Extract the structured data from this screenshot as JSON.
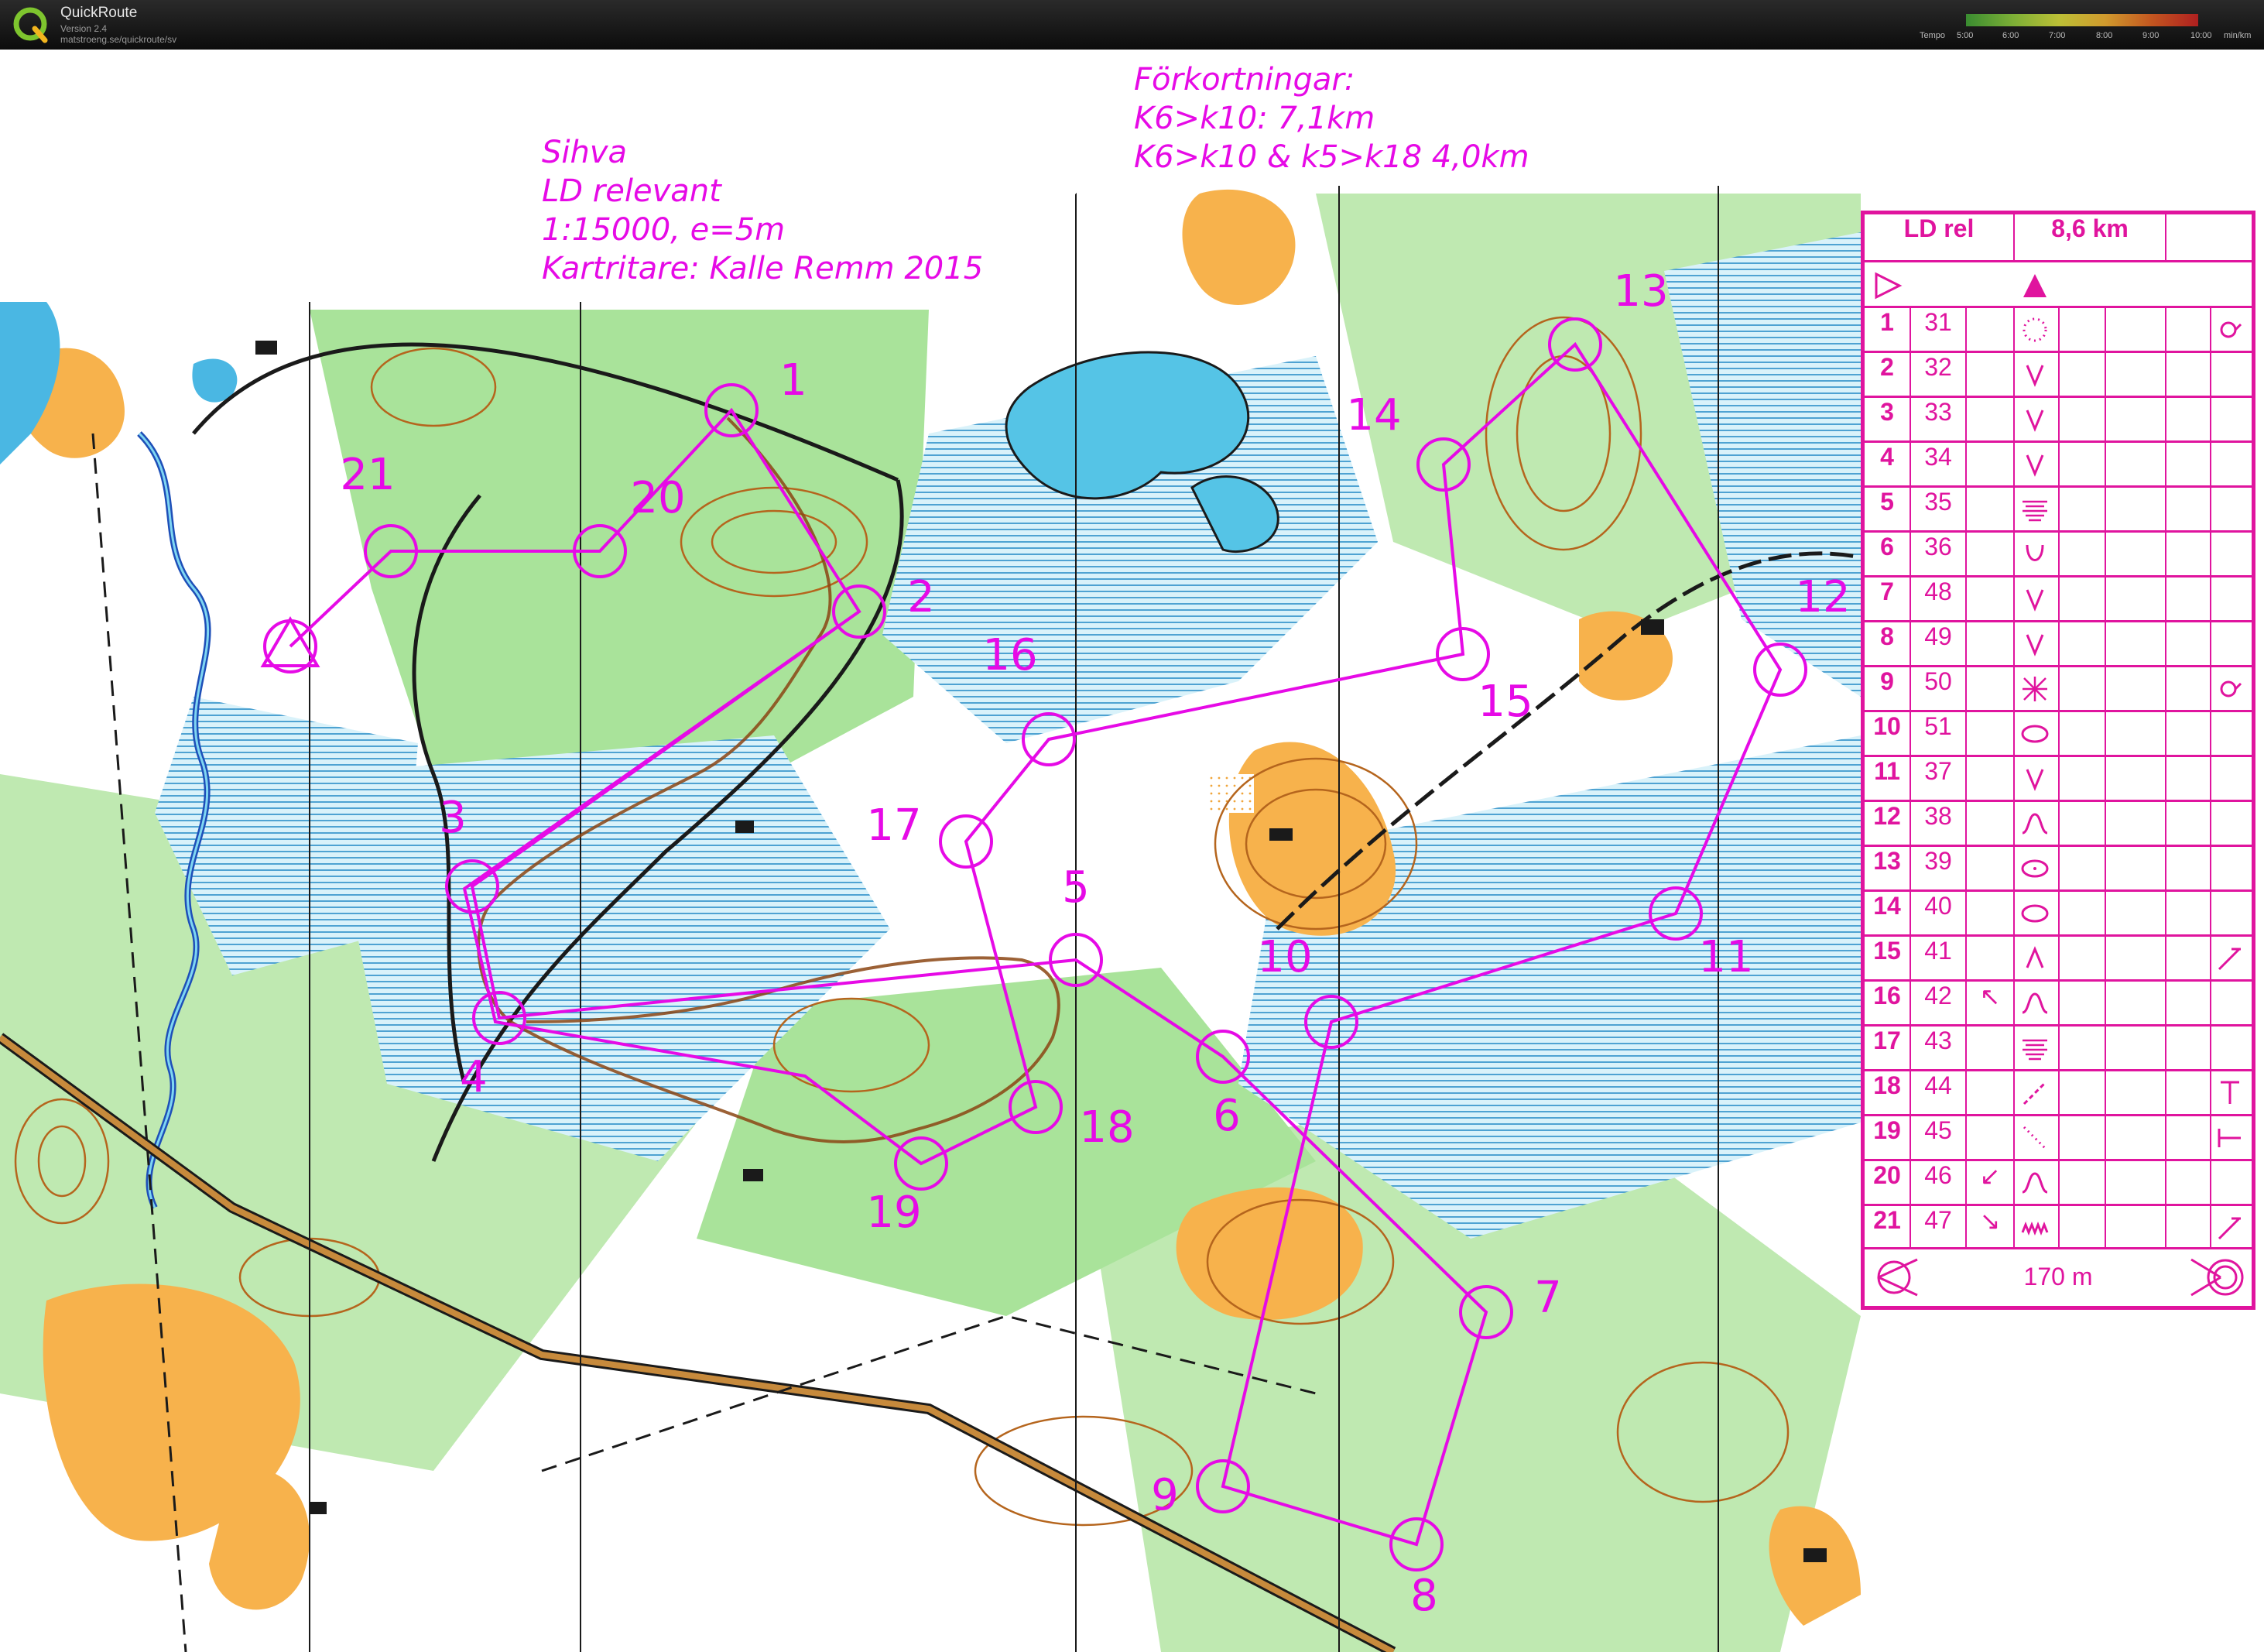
{
  "app": {
    "title": "QuickRoute",
    "version": "Version 2.4",
    "url": "matstroeng.se/quickroute/sv"
  },
  "tempo": {
    "label": "Tempo",
    "ticks": [
      "5:00",
      "6:00",
      "7:00",
      "8:00",
      "9:00",
      "10:00"
    ],
    "unit": "min/km"
  },
  "header_notes": [
    "Sihva",
    "LD relevant",
    "1:15000, e=5m",
    "Kartritare: Kalle Remm 2015"
  ],
  "shortcut_notes": [
    "Förkortningar:",
    "K6>k10: 7,1km",
    "K6>k10 & k5>k18 4,0km"
  ],
  "description": {
    "event": "LD rel",
    "length": "8,6 km",
    "finish_distance": "170 m",
    "controls": [
      {
        "n": "1",
        "code": "31",
        "sym": "dot-ring",
        "extra": "hook"
      },
      {
        "n": "2",
        "code": "32",
        "sym": "V",
        "extra": ""
      },
      {
        "n": "3",
        "code": "33",
        "sym": "V",
        "extra": ""
      },
      {
        "n": "4",
        "code": "34",
        "sym": "V",
        "extra": ""
      },
      {
        "n": "5",
        "code": "35",
        "sym": "marsh",
        "extra": ""
      },
      {
        "n": "6",
        "code": "36",
        "sym": "U",
        "extra": ""
      },
      {
        "n": "7",
        "code": "48",
        "sym": "V",
        "extra": ""
      },
      {
        "n": "8",
        "code": "49",
        "sym": "V",
        "extra": ""
      },
      {
        "n": "9",
        "code": "50",
        "sym": "thicket",
        "extra": "hook"
      },
      {
        "n": "10",
        "code": "51",
        "sym": "ellipse",
        "extra": ""
      },
      {
        "n": "11",
        "code": "37",
        "sym": "V",
        "extra": ""
      },
      {
        "n": "12",
        "code": "38",
        "sym": "knoll",
        "extra": ""
      },
      {
        "n": "13",
        "code": "39",
        "sym": "ellipse-dot",
        "extra": ""
      },
      {
        "n": "14",
        "code": "40",
        "sym": "ellipse",
        "extra": ""
      },
      {
        "n": "15",
        "code": "41",
        "sym": "Λ",
        "extra": "angle"
      },
      {
        "n": "16",
        "code": "42",
        "sym": "knoll",
        "extra": "",
        "dir": "↖"
      },
      {
        "n": "17",
        "code": "43",
        "sym": "marsh",
        "extra": ""
      },
      {
        "n": "18",
        "code": "44",
        "sym": "dash",
        "extra": "T"
      },
      {
        "n": "19",
        "code": "45",
        "sym": "dots",
        "extra": "T-side"
      },
      {
        "n": "20",
        "code": "46",
        "sym": "knoll",
        "extra": "",
        "dir": "↙"
      },
      {
        "n": "21",
        "code": "47",
        "sym": "zigzag",
        "extra": "angle",
        "dir": "↘"
      }
    ]
  },
  "course": {
    "controls": [
      {
        "n": "1"
      },
      {
        "n": "2"
      },
      {
        "n": "3"
      },
      {
        "n": "4"
      },
      {
        "n": "5"
      },
      {
        "n": "6"
      },
      {
        "n": "7"
      },
      {
        "n": "8"
      },
      {
        "n": "9"
      },
      {
        "n": "10"
      },
      {
        "n": "11"
      },
      {
        "n": "12"
      },
      {
        "n": "13"
      },
      {
        "n": "14"
      },
      {
        "n": "15"
      },
      {
        "n": "16"
      },
      {
        "n": "17"
      },
      {
        "n": "18"
      },
      {
        "n": "19"
      },
      {
        "n": "20"
      },
      {
        "n": "21"
      }
    ]
  },
  "colors": {
    "overprint": "#e60ae6",
    "description": "#e0149e",
    "forest_green": "#3cc26a",
    "open_yellow": "#f7a840",
    "water_blue": "#8fd6ec"
  }
}
